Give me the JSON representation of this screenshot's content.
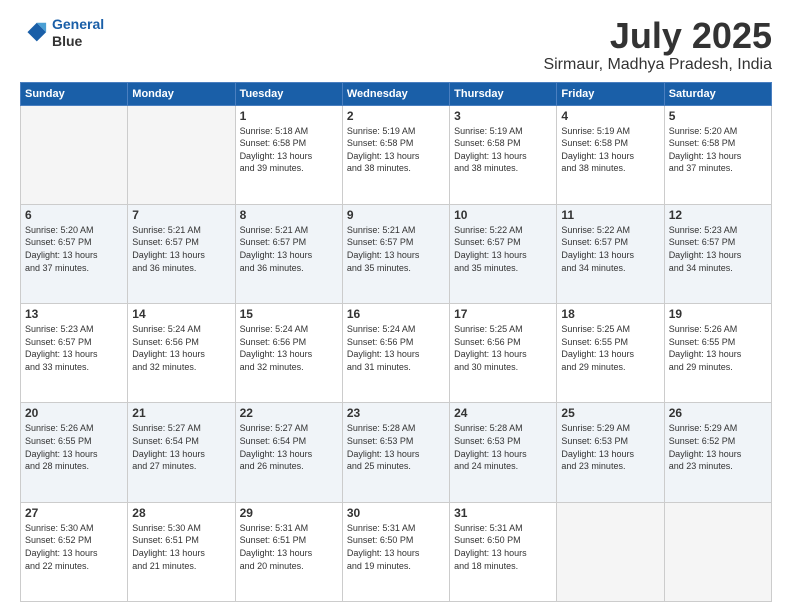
{
  "header": {
    "logo_line1": "General",
    "logo_line2": "Blue",
    "title": "July 2025",
    "subtitle": "Sirmaur, Madhya Pradesh, India"
  },
  "days_of_week": [
    "Sunday",
    "Monday",
    "Tuesday",
    "Wednesday",
    "Thursday",
    "Friday",
    "Saturday"
  ],
  "weeks": [
    [
      {
        "day": "",
        "info": ""
      },
      {
        "day": "",
        "info": ""
      },
      {
        "day": "1",
        "info": "Sunrise: 5:18 AM\nSunset: 6:58 PM\nDaylight: 13 hours\nand 39 minutes."
      },
      {
        "day": "2",
        "info": "Sunrise: 5:19 AM\nSunset: 6:58 PM\nDaylight: 13 hours\nand 38 minutes."
      },
      {
        "day": "3",
        "info": "Sunrise: 5:19 AM\nSunset: 6:58 PM\nDaylight: 13 hours\nand 38 minutes."
      },
      {
        "day": "4",
        "info": "Sunrise: 5:19 AM\nSunset: 6:58 PM\nDaylight: 13 hours\nand 38 minutes."
      },
      {
        "day": "5",
        "info": "Sunrise: 5:20 AM\nSunset: 6:58 PM\nDaylight: 13 hours\nand 37 minutes."
      }
    ],
    [
      {
        "day": "6",
        "info": "Sunrise: 5:20 AM\nSunset: 6:57 PM\nDaylight: 13 hours\nand 37 minutes."
      },
      {
        "day": "7",
        "info": "Sunrise: 5:21 AM\nSunset: 6:57 PM\nDaylight: 13 hours\nand 36 minutes."
      },
      {
        "day": "8",
        "info": "Sunrise: 5:21 AM\nSunset: 6:57 PM\nDaylight: 13 hours\nand 36 minutes."
      },
      {
        "day": "9",
        "info": "Sunrise: 5:21 AM\nSunset: 6:57 PM\nDaylight: 13 hours\nand 35 minutes."
      },
      {
        "day": "10",
        "info": "Sunrise: 5:22 AM\nSunset: 6:57 PM\nDaylight: 13 hours\nand 35 minutes."
      },
      {
        "day": "11",
        "info": "Sunrise: 5:22 AM\nSunset: 6:57 PM\nDaylight: 13 hours\nand 34 minutes."
      },
      {
        "day": "12",
        "info": "Sunrise: 5:23 AM\nSunset: 6:57 PM\nDaylight: 13 hours\nand 34 minutes."
      }
    ],
    [
      {
        "day": "13",
        "info": "Sunrise: 5:23 AM\nSunset: 6:57 PM\nDaylight: 13 hours\nand 33 minutes."
      },
      {
        "day": "14",
        "info": "Sunrise: 5:24 AM\nSunset: 6:56 PM\nDaylight: 13 hours\nand 32 minutes."
      },
      {
        "day": "15",
        "info": "Sunrise: 5:24 AM\nSunset: 6:56 PM\nDaylight: 13 hours\nand 32 minutes."
      },
      {
        "day": "16",
        "info": "Sunrise: 5:24 AM\nSunset: 6:56 PM\nDaylight: 13 hours\nand 31 minutes."
      },
      {
        "day": "17",
        "info": "Sunrise: 5:25 AM\nSunset: 6:56 PM\nDaylight: 13 hours\nand 30 minutes."
      },
      {
        "day": "18",
        "info": "Sunrise: 5:25 AM\nSunset: 6:55 PM\nDaylight: 13 hours\nand 29 minutes."
      },
      {
        "day": "19",
        "info": "Sunrise: 5:26 AM\nSunset: 6:55 PM\nDaylight: 13 hours\nand 29 minutes."
      }
    ],
    [
      {
        "day": "20",
        "info": "Sunrise: 5:26 AM\nSunset: 6:55 PM\nDaylight: 13 hours\nand 28 minutes."
      },
      {
        "day": "21",
        "info": "Sunrise: 5:27 AM\nSunset: 6:54 PM\nDaylight: 13 hours\nand 27 minutes."
      },
      {
        "day": "22",
        "info": "Sunrise: 5:27 AM\nSunset: 6:54 PM\nDaylight: 13 hours\nand 26 minutes."
      },
      {
        "day": "23",
        "info": "Sunrise: 5:28 AM\nSunset: 6:53 PM\nDaylight: 13 hours\nand 25 minutes."
      },
      {
        "day": "24",
        "info": "Sunrise: 5:28 AM\nSunset: 6:53 PM\nDaylight: 13 hours\nand 24 minutes."
      },
      {
        "day": "25",
        "info": "Sunrise: 5:29 AM\nSunset: 6:53 PM\nDaylight: 13 hours\nand 23 minutes."
      },
      {
        "day": "26",
        "info": "Sunrise: 5:29 AM\nSunset: 6:52 PM\nDaylight: 13 hours\nand 23 minutes."
      }
    ],
    [
      {
        "day": "27",
        "info": "Sunrise: 5:30 AM\nSunset: 6:52 PM\nDaylight: 13 hours\nand 22 minutes."
      },
      {
        "day": "28",
        "info": "Sunrise: 5:30 AM\nSunset: 6:51 PM\nDaylight: 13 hours\nand 21 minutes."
      },
      {
        "day": "29",
        "info": "Sunrise: 5:31 AM\nSunset: 6:51 PM\nDaylight: 13 hours\nand 20 minutes."
      },
      {
        "day": "30",
        "info": "Sunrise: 5:31 AM\nSunset: 6:50 PM\nDaylight: 13 hours\nand 19 minutes."
      },
      {
        "day": "31",
        "info": "Sunrise: 5:31 AM\nSunset: 6:50 PM\nDaylight: 13 hours\nand 18 minutes."
      },
      {
        "day": "",
        "info": ""
      },
      {
        "day": "",
        "info": ""
      }
    ]
  ]
}
